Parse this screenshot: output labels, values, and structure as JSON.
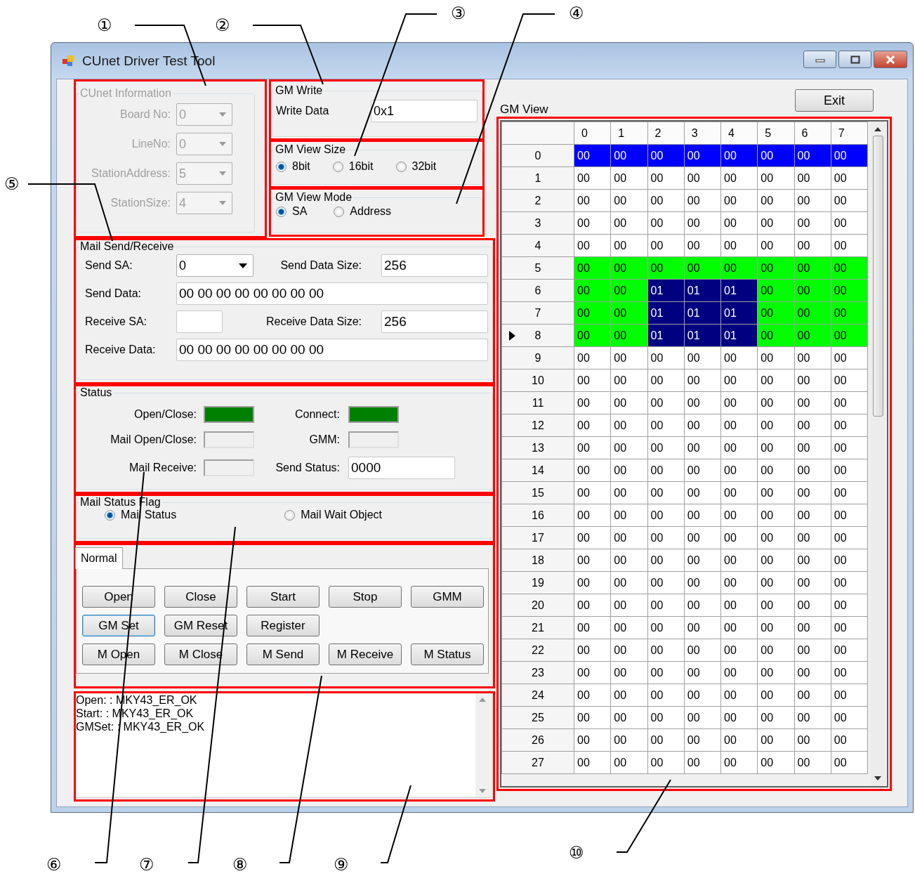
{
  "callouts": [
    {
      "label": "①"
    },
    {
      "label": "②"
    },
    {
      "label": "③"
    },
    {
      "label": "④"
    },
    {
      "label": "⑤"
    },
    {
      "label": "⑥"
    },
    {
      "label": "⑦"
    },
    {
      "label": "⑧"
    },
    {
      "label": "⑨"
    },
    {
      "label": "⑩"
    }
  ],
  "window": {
    "title": "CUnet Driver Test Tool"
  },
  "cunet_information": {
    "title": "CUnet Information",
    "disabled": true,
    "fields": [
      {
        "label": "Board No:",
        "value": "0"
      },
      {
        "label": "LineNo:",
        "value": "0"
      },
      {
        "label": "StationAddress:",
        "value": "5"
      },
      {
        "label": "StationSize:",
        "value": "4"
      }
    ]
  },
  "gm_write": {
    "title": "GM Write",
    "label": "Write Data",
    "value": "0x1"
  },
  "gm_view_size": {
    "title": "GM View Size",
    "options": [
      {
        "label": "8bit",
        "selected": true
      },
      {
        "label": "16bit",
        "selected": false
      },
      {
        "label": "32bit",
        "selected": false
      }
    ]
  },
  "gm_view_mode": {
    "title": "GM View Mode",
    "options": [
      {
        "label": "SA",
        "selected": true
      },
      {
        "label": "Address",
        "selected": false
      }
    ]
  },
  "mail_send_receive": {
    "title": "Mail Send/Receive",
    "send_sa": {
      "label": "Send SA:",
      "value": "0"
    },
    "send_data_size": {
      "label": "Send Data Size:",
      "value": "256"
    },
    "send_data": {
      "label": "Send Data:",
      "value": "00 00 00 00 00 00 00 00"
    },
    "receive_sa": {
      "label": "Receive SA:"
    },
    "receive_data_size": {
      "label": "Receive Data Size:",
      "value": "256"
    },
    "receive_data": {
      "label": "Receive Data:",
      "value": "00 00 00 00 00 00 00 00"
    }
  },
  "status": {
    "title": "Status",
    "items": [
      {
        "kind": "lamp",
        "label": "Open/Close:",
        "on": true
      },
      {
        "kind": "lamp",
        "label": "Connect:",
        "on": true
      },
      {
        "kind": "lamp",
        "label": "Mail Open/Close:",
        "on": false
      },
      {
        "kind": "lamp",
        "label": "GMM:",
        "on": false
      },
      {
        "kind": "lamp",
        "label": "Mail Receive:",
        "on": false
      },
      {
        "kind": "field",
        "label": "Send Status:",
        "value": "0000"
      }
    ]
  },
  "mail_status_flag": {
    "title": "Mail Status Flag",
    "options": [
      {
        "label": "Mail Status",
        "selected": true
      },
      {
        "label": "Mail Wait Object",
        "selected": false
      }
    ]
  },
  "tabs": [
    {
      "label": "Normal",
      "selected": true
    }
  ],
  "button_rows": [
    [
      {
        "label": "Open",
        "focused": false
      },
      {
        "label": "Close",
        "focused": false
      },
      {
        "label": "Start",
        "focused": false
      },
      {
        "label": "Stop",
        "focused": false
      },
      {
        "label": "GMM",
        "focused": false
      }
    ],
    [
      {
        "label": "GM Set",
        "focused": true
      },
      {
        "label": "GM Reset",
        "focused": false
      },
      {
        "label": "Register",
        "focused": false
      }
    ],
    [
      {
        "label": "M Open",
        "focused": false
      },
      {
        "label": "M Close",
        "focused": false
      },
      {
        "label": "M Send",
        "focused": false
      },
      {
        "label": "M Receive",
        "focused": false
      },
      {
        "label": "M Status",
        "focused": false
      }
    ]
  ],
  "log": {
    "lines": [
      "Open: : MKY43_ER_OK",
      "Start: : MKY43_ER_OK",
      "GMSet: : MKY43_ER_OK"
    ]
  },
  "exit_button": "Exit",
  "gm_view": {
    "title": "GM View",
    "columns": [
      "0",
      "1",
      "2",
      "3",
      "4",
      "5",
      "6",
      "7"
    ],
    "rows": [
      {
        "header": "0",
        "current": false,
        "color": "#0000ff",
        "cells": [
          "00",
          "00",
          "00",
          "00",
          "00",
          "00",
          "00",
          "00"
        ],
        "selected": [
          false,
          false,
          false,
          false,
          false,
          false,
          false,
          false
        ]
      },
      {
        "header": "1",
        "current": false,
        "cells": [
          "00",
          "00",
          "00",
          "00",
          "00",
          "00",
          "00",
          "00"
        ],
        "selected": [
          false,
          false,
          false,
          false,
          false,
          false,
          false,
          false
        ]
      },
      {
        "header": "2",
        "current": false,
        "cells": [
          "00",
          "00",
          "00",
          "00",
          "00",
          "00",
          "00",
          "00"
        ],
        "selected": [
          false,
          false,
          false,
          false,
          false,
          false,
          false,
          false
        ]
      },
      {
        "header": "3",
        "current": false,
        "cells": [
          "00",
          "00",
          "00",
          "00",
          "00",
          "00",
          "00",
          "00"
        ],
        "selected": [
          false,
          false,
          false,
          false,
          false,
          false,
          false,
          false
        ]
      },
      {
        "header": "4",
        "current": false,
        "cells": [
          "00",
          "00",
          "00",
          "00",
          "00",
          "00",
          "00",
          "00"
        ],
        "selected": [
          false,
          false,
          false,
          false,
          false,
          false,
          false,
          false
        ]
      },
      {
        "header": "5",
        "current": false,
        "color": "#00ff00",
        "cells": [
          "00",
          "00",
          "00",
          "00",
          "00",
          "00",
          "00",
          "00"
        ],
        "selected": [
          false,
          false,
          false,
          false,
          false,
          false,
          false,
          false
        ]
      },
      {
        "header": "6",
        "current": false,
        "color": "#00ff00",
        "cells": [
          "00",
          "00",
          "01",
          "01",
          "01",
          "00",
          "00",
          "00"
        ],
        "selected": [
          false,
          false,
          true,
          true,
          true,
          false,
          false,
          false
        ]
      },
      {
        "header": "7",
        "current": false,
        "color": "#00ff00",
        "cells": [
          "00",
          "00",
          "01",
          "01",
          "01",
          "00",
          "00",
          "00"
        ],
        "selected": [
          false,
          false,
          true,
          true,
          true,
          false,
          false,
          false
        ]
      },
      {
        "header": "8",
        "current": true,
        "color": "#00ff00",
        "cells": [
          "00",
          "00",
          "01",
          "01",
          "01",
          "00",
          "00",
          "00"
        ],
        "selected": [
          false,
          false,
          true,
          true,
          true,
          false,
          false,
          false
        ]
      },
      {
        "header": "9",
        "current": false,
        "cells": [
          "00",
          "00",
          "00",
          "00",
          "00",
          "00",
          "00",
          "00"
        ],
        "selected": [
          false,
          false,
          false,
          false,
          false,
          false,
          false,
          false
        ]
      },
      {
        "header": "10",
        "current": false,
        "cells": [
          "00",
          "00",
          "00",
          "00",
          "00",
          "00",
          "00",
          "00"
        ],
        "selected": [
          false,
          false,
          false,
          false,
          false,
          false,
          false,
          false
        ]
      },
      {
        "header": "11",
        "current": false,
        "cells": [
          "00",
          "00",
          "00",
          "00",
          "00",
          "00",
          "00",
          "00"
        ],
        "selected": [
          false,
          false,
          false,
          false,
          false,
          false,
          false,
          false
        ]
      },
      {
        "header": "12",
        "current": false,
        "cells": [
          "00",
          "00",
          "00",
          "00",
          "00",
          "00",
          "00",
          "00"
        ],
        "selected": [
          false,
          false,
          false,
          false,
          false,
          false,
          false,
          false
        ]
      },
      {
        "header": "13",
        "current": false,
        "cells": [
          "00",
          "00",
          "00",
          "00",
          "00",
          "00",
          "00",
          "00"
        ],
        "selected": [
          false,
          false,
          false,
          false,
          false,
          false,
          false,
          false
        ]
      },
      {
        "header": "14",
        "current": false,
        "cells": [
          "00",
          "00",
          "00",
          "00",
          "00",
          "00",
          "00",
          "00"
        ],
        "selected": [
          false,
          false,
          false,
          false,
          false,
          false,
          false,
          false
        ]
      },
      {
        "header": "15",
        "current": false,
        "cells": [
          "00",
          "00",
          "00",
          "00",
          "00",
          "00",
          "00",
          "00"
        ],
        "selected": [
          false,
          false,
          false,
          false,
          false,
          false,
          false,
          false
        ]
      },
      {
        "header": "16",
        "current": false,
        "cells": [
          "00",
          "00",
          "00",
          "00",
          "00",
          "00",
          "00",
          "00"
        ],
        "selected": [
          false,
          false,
          false,
          false,
          false,
          false,
          false,
          false
        ]
      },
      {
        "header": "17",
        "current": false,
        "cells": [
          "00",
          "00",
          "00",
          "00",
          "00",
          "00",
          "00",
          "00"
        ],
        "selected": [
          false,
          false,
          false,
          false,
          false,
          false,
          false,
          false
        ]
      },
      {
        "header": "18",
        "current": false,
        "cells": [
          "00",
          "00",
          "00",
          "00",
          "00",
          "00",
          "00",
          "00"
        ],
        "selected": [
          false,
          false,
          false,
          false,
          false,
          false,
          false,
          false
        ]
      },
      {
        "header": "19",
        "current": false,
        "cells": [
          "00",
          "00",
          "00",
          "00",
          "00",
          "00",
          "00",
          "00"
        ],
        "selected": [
          false,
          false,
          false,
          false,
          false,
          false,
          false,
          false
        ]
      },
      {
        "header": "20",
        "current": false,
        "cells": [
          "00",
          "00",
          "00",
          "00",
          "00",
          "00",
          "00",
          "00"
        ],
        "selected": [
          false,
          false,
          false,
          false,
          false,
          false,
          false,
          false
        ]
      },
      {
        "header": "21",
        "current": false,
        "cells": [
          "00",
          "00",
          "00",
          "00",
          "00",
          "00",
          "00",
          "00"
        ],
        "selected": [
          false,
          false,
          false,
          false,
          false,
          false,
          false,
          false
        ]
      },
      {
        "header": "22",
        "current": false,
        "cells": [
          "00",
          "00",
          "00",
          "00",
          "00",
          "00",
          "00",
          "00"
        ],
        "selected": [
          false,
          false,
          false,
          false,
          false,
          false,
          false,
          false
        ]
      },
      {
        "header": "23",
        "current": false,
        "cells": [
          "00",
          "00",
          "00",
          "00",
          "00",
          "00",
          "00",
          "00"
        ],
        "selected": [
          false,
          false,
          false,
          false,
          false,
          false,
          false,
          false
        ]
      },
      {
        "header": "24",
        "current": false,
        "cells": [
          "00",
          "00",
          "00",
          "00",
          "00",
          "00",
          "00",
          "00"
        ],
        "selected": [
          false,
          false,
          false,
          false,
          false,
          false,
          false,
          false
        ]
      },
      {
        "header": "25",
        "current": false,
        "cells": [
          "00",
          "00",
          "00",
          "00",
          "00",
          "00",
          "00",
          "00"
        ],
        "selected": [
          false,
          false,
          false,
          false,
          false,
          false,
          false,
          false
        ]
      },
      {
        "header": "26",
        "current": false,
        "cells": [
          "00",
          "00",
          "00",
          "00",
          "00",
          "00",
          "00",
          "00"
        ],
        "selected": [
          false,
          false,
          false,
          false,
          false,
          false,
          false,
          false
        ]
      },
      {
        "header": "27",
        "current": false,
        "cells": [
          "00",
          "00",
          "00",
          "00",
          "00",
          "00",
          "00",
          "00"
        ],
        "selected": [
          false,
          false,
          false,
          false,
          false,
          false,
          false,
          false
        ]
      }
    ]
  }
}
